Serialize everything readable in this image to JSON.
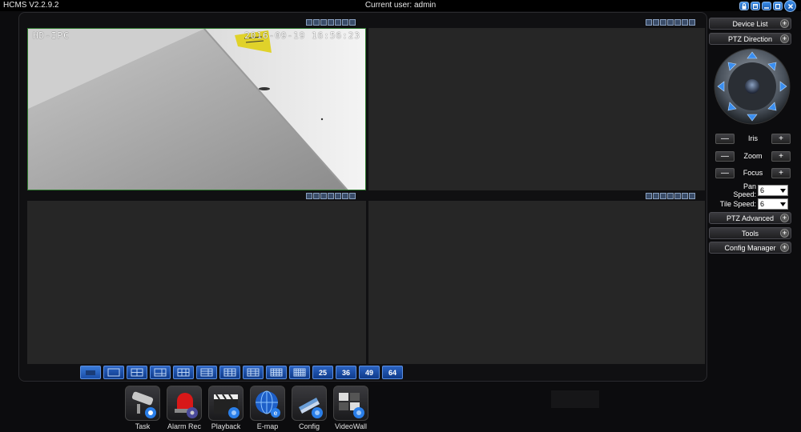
{
  "app": {
    "title": "HCMS V2.2.9.2",
    "current_user": "Current user: admin"
  },
  "window_buttons": [
    "lock-icon",
    "restore-icon",
    "minimize-icon",
    "maximize-icon",
    "close-icon"
  ],
  "video": {
    "pane1": {
      "channel_name": "HD-IPC",
      "timestamp": "2016-09-19  16:56:23"
    }
  },
  "layout_buttons": {
    "numbered": [
      "25",
      "36",
      "49",
      "64"
    ]
  },
  "dock": [
    {
      "key": "task",
      "label": "Task",
      "icon": "camera-icon"
    },
    {
      "key": "alarm",
      "label": "Alarm Rec",
      "icon": "alarm-icon"
    },
    {
      "key": "playback",
      "label": "Playback",
      "icon": "clapper-icon"
    },
    {
      "key": "emap",
      "label": "E-map",
      "icon": "globe-icon"
    },
    {
      "key": "config",
      "label": "Config",
      "icon": "gear-icon"
    },
    {
      "key": "videowall",
      "label": "VideoWall",
      "icon": "videowall-icon"
    }
  ],
  "side": {
    "device_list": "Device List",
    "ptz_direction": "PTZ Direction",
    "iris": "Iris",
    "zoom": "Zoom",
    "focus": "Focus",
    "minus": "—",
    "plus": "+",
    "pan_speed_label": "Pan Speed:",
    "pan_speed_value": "6",
    "tile_speed_label": "Tile Speed:",
    "tile_speed_value": "6",
    "ptz_advanced": "PTZ Advanced",
    "tools": "Tools",
    "config_manager": "Config Manager"
  },
  "colors": {
    "accent_blue": "#2b63c2",
    "pane_bg": "#262626",
    "selected_pane_border": "#2f7a2f"
  }
}
